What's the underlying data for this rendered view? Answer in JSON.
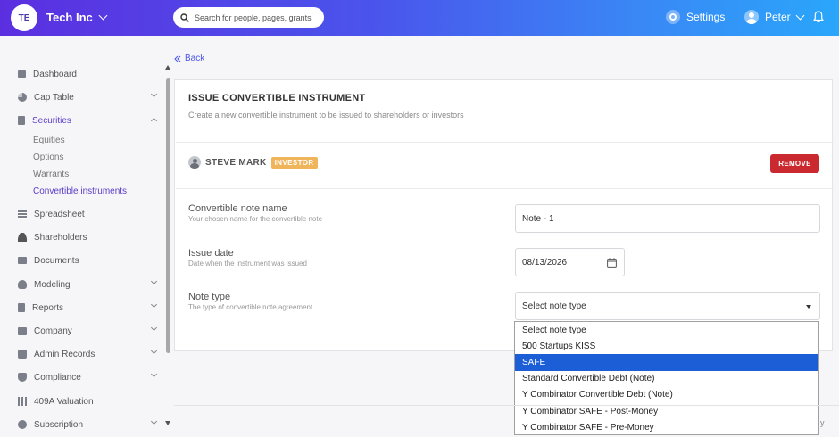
{
  "header": {
    "logo_initials": "TE",
    "company_name": "Tech Inc",
    "search_placeholder": "Search for people, pages, grants",
    "settings_label": "Settings",
    "user_name": "Peter"
  },
  "sidebar": {
    "items": [
      {
        "label": "Dashboard"
      },
      {
        "label": "Cap Table"
      },
      {
        "label": "Securities"
      },
      {
        "label": "Spreadsheet"
      },
      {
        "label": "Shareholders"
      },
      {
        "label": "Documents"
      },
      {
        "label": "Modeling"
      },
      {
        "label": "Reports"
      },
      {
        "label": "Company"
      },
      {
        "label": "Admin Records"
      },
      {
        "label": "Compliance"
      },
      {
        "label": "409A Valuation"
      },
      {
        "label": "Subscription"
      }
    ],
    "securities_sub": [
      {
        "label": "Equities"
      },
      {
        "label": "Options"
      },
      {
        "label": "Warrants"
      },
      {
        "label": "Convertible instruments"
      }
    ]
  },
  "main": {
    "back_label": "Back",
    "title": "ISSUE CONVERTIBLE INSTRUMENT",
    "subtitle": "Create a new convertible instrument to be issued to shareholders or investors",
    "investor_name": "STEVE MARK",
    "investor_badge": "INVESTOR",
    "remove_label": "REMOVE",
    "fields": {
      "note_name_label": "Convertible note name",
      "note_name_help": "Your chosen name for the convertible note",
      "note_name_value": "Note - 1",
      "issue_date_label": "Issue date",
      "issue_date_help": "Date when the instrument was issued",
      "issue_date_value": "08/13/2026",
      "note_type_label": "Note type",
      "note_type_help": "The type of convertible note agreement",
      "note_type_value": "Select note type"
    },
    "note_type_options": [
      "Select note type",
      "500 Startups KISS",
      "SAFE",
      "Standard Convertible Debt (Note)",
      "Y Combinator Convertible Debt (Note)",
      "Y Combinator SAFE - Post-Money",
      "Y Combinator SAFE - Pre-Money"
    ],
    "highlighted_option": "SAFE",
    "footer_text": "y"
  },
  "colors": {
    "accent": "#5b3bc7",
    "link": "#4a55ec",
    "danger": "#c9292f",
    "badge": "#f0b45a",
    "selection": "#1c5ed6"
  }
}
